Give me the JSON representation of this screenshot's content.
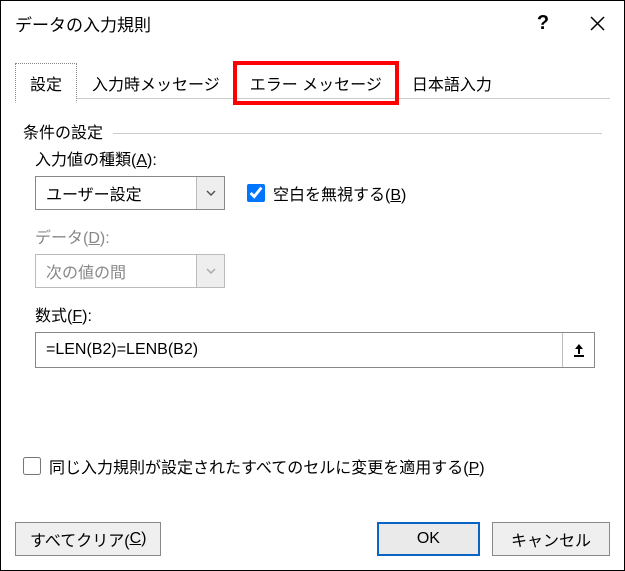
{
  "titlebar": {
    "title": "データの入力規則"
  },
  "tabs": {
    "settings": "設定",
    "input_message": "入力時メッセージ",
    "error_message": "エラー メッセージ",
    "ime": "日本語入力"
  },
  "group": {
    "title": "条件の設定"
  },
  "allow": {
    "label_main": "入力値の種類(",
    "label_key": "A",
    "label_end": "):",
    "value": "ユーザー設定"
  },
  "ignore_blank": {
    "label_main": "空白を無視する(",
    "label_key": "B",
    "label_end": ")"
  },
  "data": {
    "label_main": "データ(",
    "label_key": "D",
    "label_end": "):",
    "value": "次の値の間"
  },
  "formula": {
    "label_main": "数式(",
    "label_key": "F",
    "label_end": "):",
    "value": "=LEN(B2)=LENB(B2)"
  },
  "apply": {
    "label_main": "同じ入力規則が設定されたすべてのセルに変更を適用する(",
    "label_key": "P",
    "label_end": ")"
  },
  "buttons": {
    "clear_main": "すべてクリア(",
    "clear_key": "C",
    "clear_end": ")",
    "ok": "OK",
    "cancel": "キャンセル"
  }
}
